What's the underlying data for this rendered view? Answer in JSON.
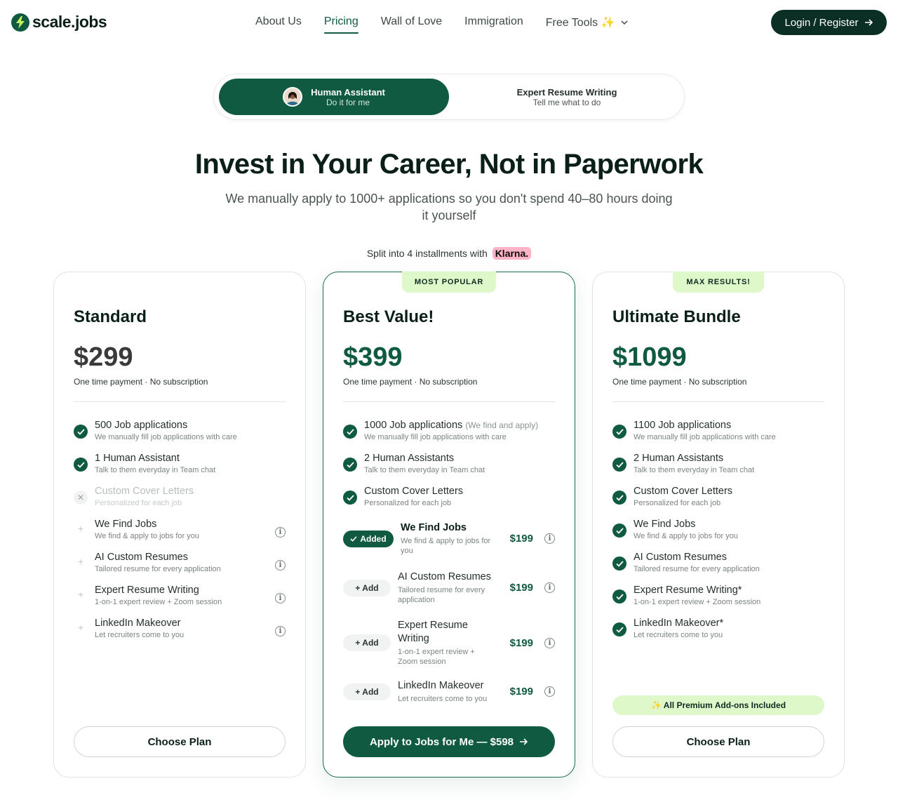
{
  "header": {
    "logo_text": "scale.jobs",
    "nav": [
      {
        "label": "About Us",
        "active": false
      },
      {
        "label": "Pricing",
        "active": true
      },
      {
        "label": "Wall of Love",
        "active": false
      },
      {
        "label": "Immigration",
        "active": false
      },
      {
        "label": "Free Tools ✨",
        "active": false
      }
    ],
    "login_label": "Login / Register"
  },
  "toggle": {
    "left": {
      "title": "Human Assistant",
      "subtitle": "Do it for me"
    },
    "right": {
      "title": "Expert Resume Writing",
      "subtitle": "Tell me what to do"
    }
  },
  "hero": {
    "title": "Invest in Your Career, Not in Paperwork",
    "subtitle": "We manually apply to 1000+ applications so you don't spend 40–80 hours doing it yourself",
    "installments_text": "Split into 4 installments with",
    "klarna": "Klarna."
  },
  "plans": {
    "standard": {
      "title": "Standard",
      "price": "$299",
      "payment": "One time payment · No subscription",
      "features": [
        {
          "name": "500 Job applications",
          "desc": "We manually fill job applications with care"
        },
        {
          "name": "1 Human Assistant",
          "desc": "Talk to them everyday in Team chat"
        },
        {
          "name": "Custom Cover Letters",
          "desc": "Personalized for each job"
        },
        {
          "name": "We Find Jobs",
          "desc": "We find & apply to jobs for you"
        },
        {
          "name": "AI Custom Resumes",
          "desc": "Tailored resume for every application"
        },
        {
          "name": "Expert Resume Writing",
          "desc": "1-on-1 expert review + Zoom session"
        },
        {
          "name": "LinkedIn Makeover",
          "desc": "Let recruiters come to you"
        }
      ],
      "button": "Choose Plan"
    },
    "best": {
      "badge": "MOST POPULAR",
      "title": "Best Value!",
      "price": "$399",
      "payment": "One time payment · No subscription",
      "features": [
        {
          "name": "1000 Job applications",
          "note": "(We find and apply)",
          "desc": "We manually fill job applications with care"
        },
        {
          "name": "2 Human Assistants",
          "desc": "Talk to them everyday in Team chat"
        },
        {
          "name": "Custom Cover Letters",
          "desc": "Personalized for each job"
        }
      ],
      "addons": [
        {
          "state": "Added",
          "name": "We Find Jobs",
          "desc": "We find & apply to jobs for you",
          "price": "$199"
        },
        {
          "state": "+ Add",
          "name": "AI Custom Resumes",
          "desc": "Tailored resume for every application",
          "price": "$199"
        },
        {
          "state": "+ Add",
          "name": "Expert Resume Writing",
          "desc": "1-on-1 expert review + Zoom session",
          "price": "$199"
        },
        {
          "state": "+ Add",
          "name": "LinkedIn Makeover",
          "desc": "Let recruiters come to you",
          "price": "$199"
        }
      ],
      "button": "Apply to Jobs for Me — $598"
    },
    "ultimate": {
      "badge": "MAX RESULTS!",
      "title": "Ultimate Bundle",
      "price": "$1099",
      "payment": "One time payment · No subscription",
      "features": [
        {
          "name": "1100 Job applications",
          "desc": "We manually fill job applications with care"
        },
        {
          "name": "2 Human Assistants",
          "desc": "Talk to them everyday in Team chat"
        },
        {
          "name": "Custom Cover Letters",
          "desc": "Personalized for each job"
        },
        {
          "name": "We Find Jobs",
          "desc": "We find & apply to jobs for you"
        },
        {
          "name": "AI Custom Resumes",
          "desc": "Tailored resume for every application"
        },
        {
          "name": "Expert Resume Writing*",
          "desc": "1-on-1 expert review + Zoom session"
        },
        {
          "name": "LinkedIn Makeover*",
          "desc": "Let recruiters come to you"
        }
      ],
      "premium_note": "✨ All Premium Add-ons Included",
      "button": "Choose Plan"
    }
  },
  "colors": {
    "brand": "#0f5a40",
    "brand_dark": "#0b2f25",
    "badge_bg": "#dff8c9",
    "klarna_pink": "#ffb3c7"
  }
}
